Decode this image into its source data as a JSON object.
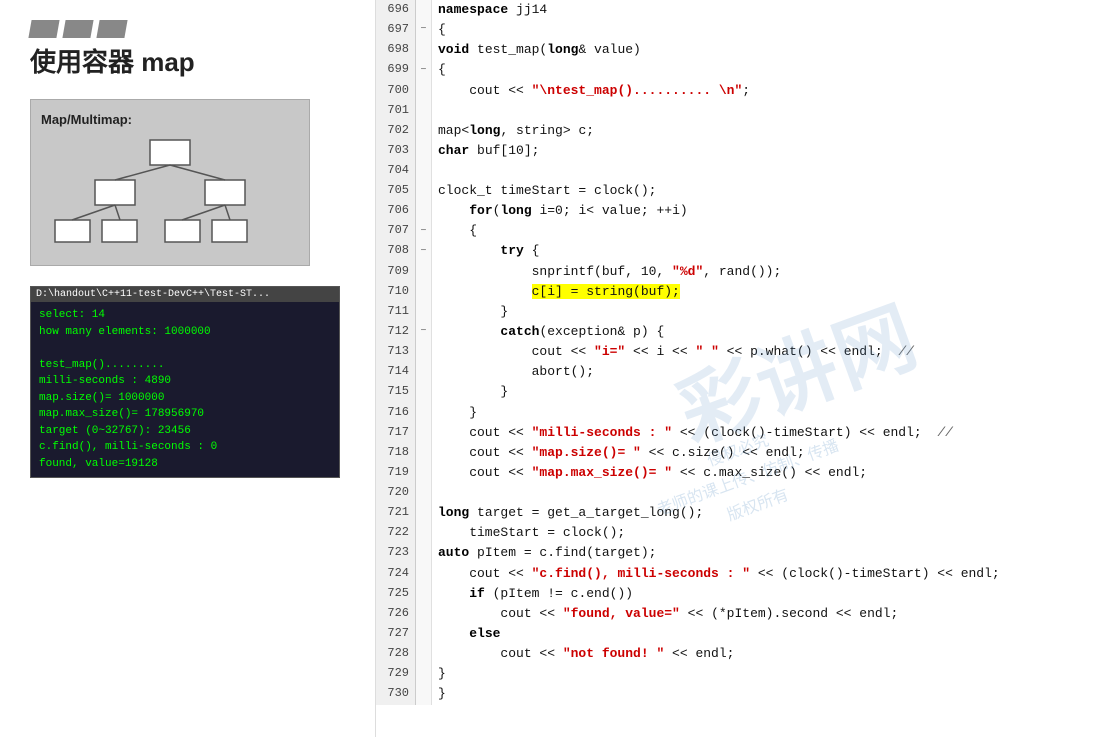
{
  "left": {
    "bars": [
      "bar1",
      "bar2",
      "bar3"
    ],
    "title": "使用容器 map",
    "tree": {
      "label": "Map/Multimap:"
    },
    "terminal": {
      "title": "D:\\handout\\C++11-test-DevC++\\Test-ST...",
      "lines": [
        "select: 14",
        "how many elements: 1000000",
        "",
        "test_map().........",
        "milli-seconds : 4890",
        "map.size()= 1000000",
        "map.max_size()= 178956970",
        "target (0~32767): 23456",
        "c.find(), milli-seconds : 0",
        "found, value=19128"
      ]
    }
  },
  "code": {
    "rows": [
      {
        "num": "696",
        "fold": "",
        "content": "namespace jj14",
        "raw": true
      },
      {
        "num": "697",
        "fold": "−",
        "content": "{",
        "raw": true
      },
      {
        "num": "698",
        "fold": "",
        "content": "void test_map(long& value)",
        "raw": true
      },
      {
        "num": "699",
        "fold": "−",
        "content": "{",
        "raw": true
      },
      {
        "num": "700",
        "fold": "",
        "content": "    cout << \"\\ntest_map().......... \\n\";",
        "raw": true
      },
      {
        "num": "701",
        "fold": "",
        "content": "",
        "raw": true
      },
      {
        "num": "702",
        "fold": "",
        "content": "map<long, string> c;",
        "raw": true
      },
      {
        "num": "703",
        "fold": "",
        "content": "char buf[10];",
        "raw": true
      },
      {
        "num": "704",
        "fold": "",
        "content": "",
        "raw": true
      },
      {
        "num": "705",
        "fold": "",
        "content": "clock_t timeStart = clock();",
        "raw": true
      },
      {
        "num": "706",
        "fold": "",
        "content": "    for(long i=0; i< value; ++i)",
        "raw": true
      },
      {
        "num": "707",
        "fold": "−",
        "content": "    {",
        "raw": true
      },
      {
        "num": "708",
        "fold": "−",
        "content": "        try {",
        "raw": true
      },
      {
        "num": "709",
        "fold": "",
        "content": "            snprintf(buf, 10, \"%d\", rand());",
        "raw": true
      },
      {
        "num": "710",
        "fold": "",
        "content": "            c[i] = string(buf);",
        "raw": true,
        "highlight": true
      },
      {
        "num": "711",
        "fold": "",
        "content": "        }",
        "raw": true
      },
      {
        "num": "712",
        "fold": "−",
        "content": "        catch(exception& p) {",
        "raw": true
      },
      {
        "num": "713",
        "fold": "",
        "content": "            cout << \"i=\" << i << \" \" << p.what() << endl;  //",
        "raw": true
      },
      {
        "num": "714",
        "fold": "",
        "content": "            abort();",
        "raw": true
      },
      {
        "num": "715",
        "fold": "",
        "content": "        }",
        "raw": true
      },
      {
        "num": "716",
        "fold": "",
        "content": "    }",
        "raw": true
      },
      {
        "num": "717",
        "fold": "",
        "content": "    cout << \"milli-seconds : \" << (clock()-timeStart) << endl;  //",
        "raw": true
      },
      {
        "num": "718",
        "fold": "",
        "content": "    cout << \"map.size()= \" << c.size() << endl;",
        "raw": true
      },
      {
        "num": "719",
        "fold": "",
        "content": "    cout << \"map.max_size()= \" << c.max_size() << endl;",
        "raw": true
      },
      {
        "num": "720",
        "fold": "",
        "content": "",
        "raw": true
      },
      {
        "num": "721",
        "fold": "",
        "content": "long target = get_a_target_long();",
        "raw": true
      },
      {
        "num": "722",
        "fold": "",
        "content": "    timeStart = clock();",
        "raw": true
      },
      {
        "num": "723",
        "fold": "",
        "content": "auto pItem = c.find(target);",
        "raw": true
      },
      {
        "num": "724",
        "fold": "",
        "content": "    cout << \"c.find(), milli-seconds : \" << (clock()-timeStart) << endl;",
        "raw": true
      },
      {
        "num": "725",
        "fold": "",
        "content": "    if (pItem != c.end())",
        "raw": true
      },
      {
        "num": "726",
        "fold": "",
        "content": "        cout << \"found, value=\" << (*pItem).second << endl;",
        "raw": true
      },
      {
        "num": "727",
        "fold": "",
        "content": "    else",
        "raw": true
      },
      {
        "num": "728",
        "fold": "",
        "content": "        cout << \"not found! \" << endl;",
        "raw": true
      },
      {
        "num": "729",
        "fold": "",
        "content": "}",
        "raw": true
      },
      {
        "num": "730",
        "fold": "",
        "content": "}",
        "raw": true
      }
    ]
  }
}
